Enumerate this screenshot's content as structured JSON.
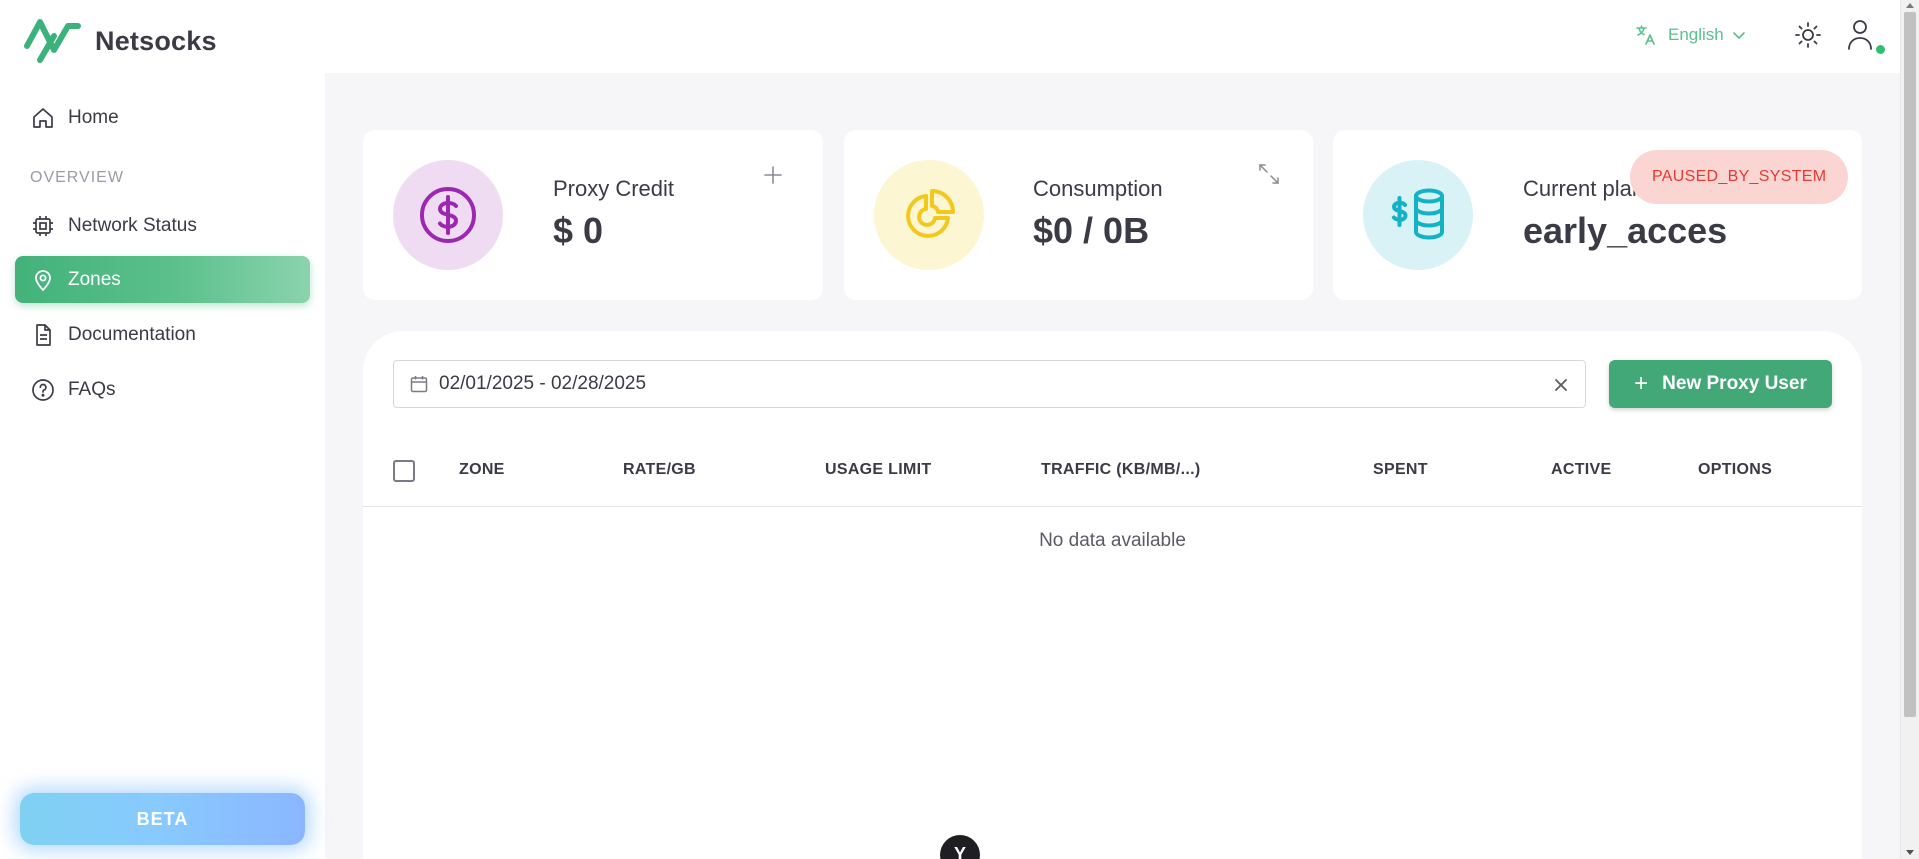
{
  "app": {
    "name": "Netsocks",
    "brand_color": "#5ac08f"
  },
  "header": {
    "language": "English",
    "icons": [
      "translate-icon",
      "chevron-down-icon",
      "sun-icon",
      "user-icon"
    ]
  },
  "sidebar": {
    "items": [
      {
        "label": "Home",
        "icon": "home-icon",
        "active": false
      },
      {
        "label": "Network Status",
        "icon": "chip-icon",
        "active": false
      },
      {
        "label": "Zones",
        "icon": "location-pin-icon",
        "active": true
      },
      {
        "label": "Documentation",
        "icon": "document-icon",
        "active": false
      },
      {
        "label": "FAQs",
        "icon": "question-circle-icon",
        "active": false
      }
    ],
    "section_overview": "OVERVIEW",
    "beta_label": "BETA"
  },
  "cards": {
    "credit": {
      "label": "Proxy Credit",
      "value": "$ 0",
      "icon": "dollar-circle-icon",
      "accent": "#9c27b0"
    },
    "consumption": {
      "label": "Consumption",
      "value": "$0 / 0B",
      "icon": "pie-chart-icon",
      "accent": "#f2c81e"
    },
    "plan": {
      "label": "Current plan",
      "value": "early_acces",
      "icon": "dollar-database-icon",
      "accent": "#14b2c7",
      "status": "PAUSED_BY_SYSTEM",
      "status_color": "#e23b32"
    }
  },
  "filters": {
    "date_range": "02/01/2025 - 02/28/2025",
    "new_user_label": "New Proxy User"
  },
  "table": {
    "columns": [
      "ZONE",
      "RATE/GB",
      "USAGE LIMIT",
      "TRAFFIC (KB/MB/...)",
      "SPENT",
      "ACTIVE",
      "OPTIONS"
    ],
    "rows": [],
    "empty_text": "No data available"
  },
  "bubble_label": "Y"
}
